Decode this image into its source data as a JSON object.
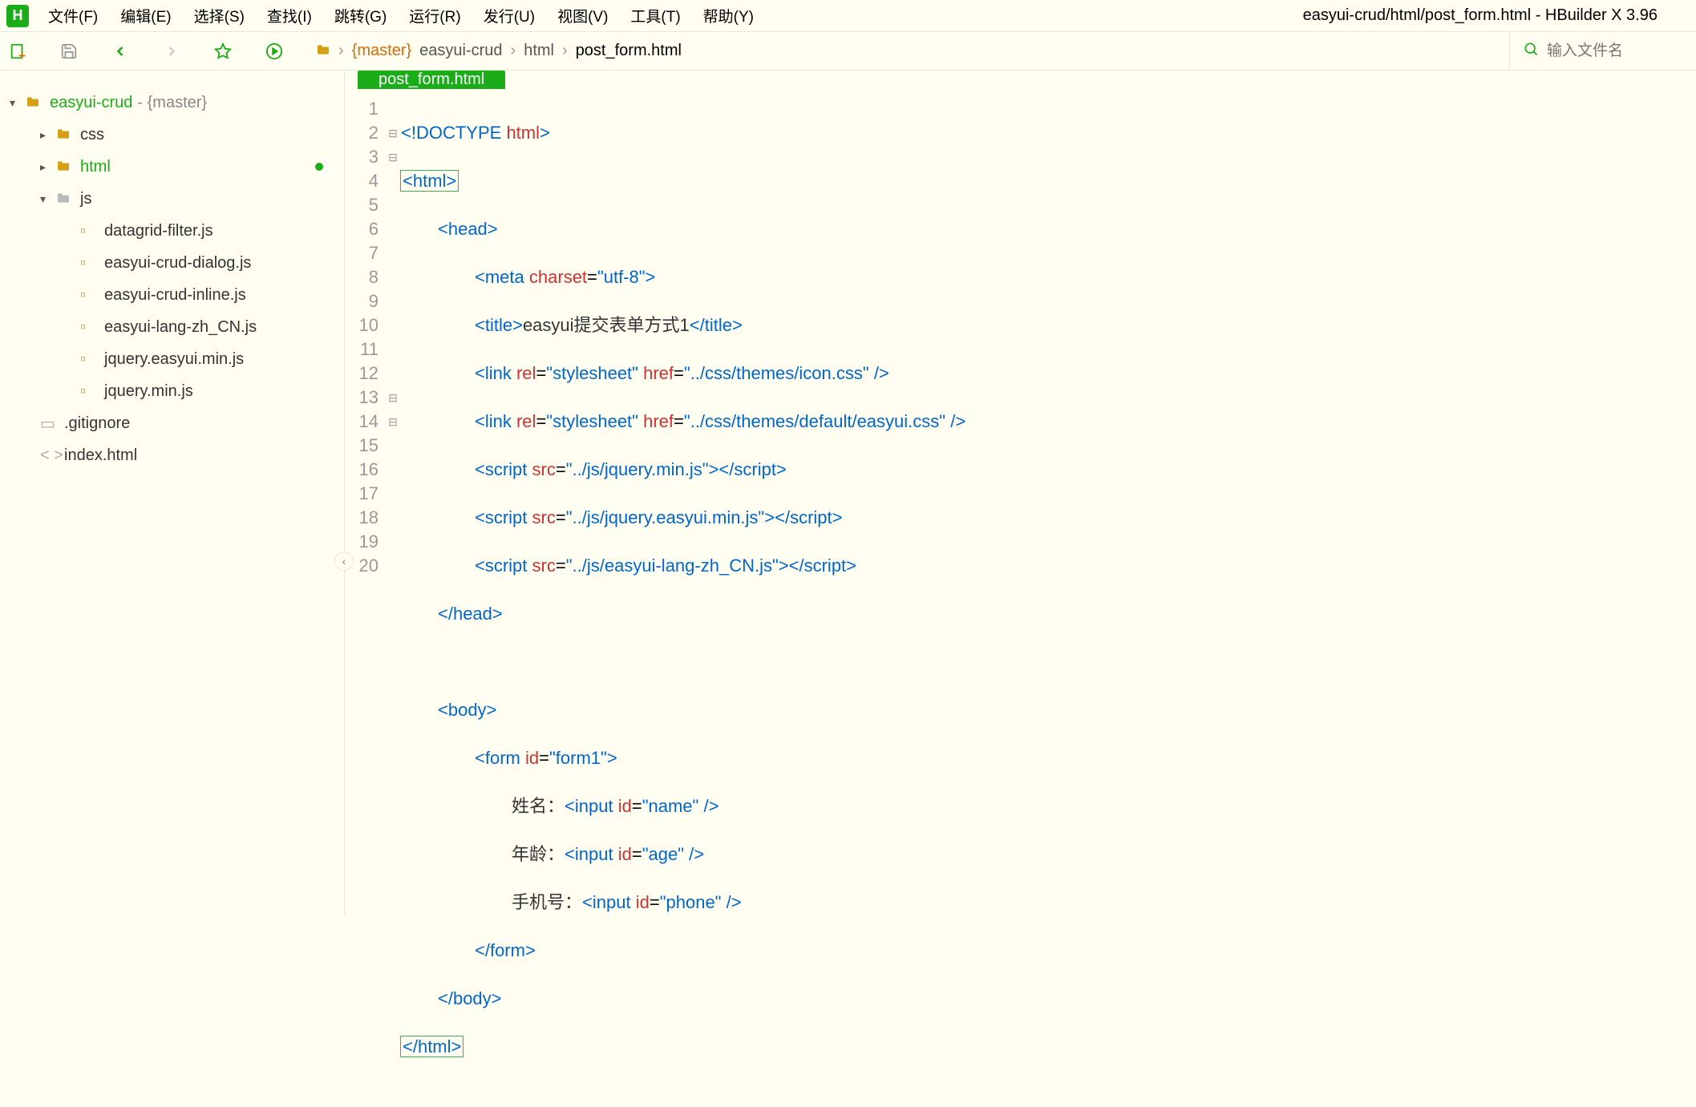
{
  "app": {
    "title": "easyui-crud/html/post_form.html - HBuilder X 3.96",
    "logo": "H"
  },
  "menu": {
    "file": "文件(F)",
    "edit": "编辑(E)",
    "select": "选择(S)",
    "find": "查找(I)",
    "goto": "跳转(G)",
    "run": "运行(R)",
    "publish": "发行(U)",
    "view": "视图(V)",
    "tools": "工具(T)",
    "help": "帮助(Y)"
  },
  "search": {
    "placeholder": "输入文件名"
  },
  "breadcrumb": {
    "branch": "{master}",
    "parts": [
      "easyui-crud",
      "html"
    ],
    "file": "post_form.html"
  },
  "sidebar": {
    "root": {
      "name": "easyui-crud",
      "branch": "- {master}"
    },
    "folders": [
      {
        "name": "css",
        "expanded": false
      },
      {
        "name": "html",
        "expanded": false,
        "active": true
      },
      {
        "name": "js",
        "expanded": true,
        "files": [
          "datagrid-filter.js",
          "easyui-crud-dialog.js",
          "easyui-crud-inline.js",
          "easyui-lang-zh_CN.js",
          "jquery.easyui.min.js",
          "jquery.min.js"
        ]
      }
    ],
    "rootFiles": [
      {
        "name": ".gitignore",
        "icon": "file"
      },
      {
        "name": "index.html",
        "icon": "code"
      }
    ]
  },
  "tab": {
    "label": "post_form.html"
  },
  "code": {
    "lineCount": 20,
    "folds": {
      "2": "⊟",
      "3": "⊟",
      "13": "⊟",
      "14": "⊟"
    }
  },
  "strings": {
    "doctype": "<!DOCTYPE",
    "html_kw": "html",
    "html_open": "<html>",
    "html_close": "</html>",
    "head_open": "<head>",
    "head_close": "</head>",
    "body_open": "<body>",
    "body_close": "</body>",
    "meta": "<meta",
    "charset": "charset",
    "charset_val": "\"utf-8\"",
    "title_open": "<title>",
    "title_text": "easyui提交表单方式1",
    "title_close": "</title>",
    "link": "<link",
    "rel": "rel",
    "rel_val": "\"stylesheet\"",
    "href": "href",
    "href1": "\"../css/themes/icon.css\"",
    "href2": "\"../css/themes/default/easyui.css\"",
    "selfclose": "/>",
    "gt": ">",
    "script_open": "<script",
    "script_close": "</script>",
    "src": "src",
    "src1": "\"../js/jquery.min.js\"",
    "src2": "\"../js/jquery.easyui.min.js\"",
    "src3": "\"../js/easyui-lang-zh_CN.js\"",
    "form_open": "<form",
    "id": "id",
    "form_id": "\"form1\"",
    "form_close": "</form>",
    "label_name": "姓名：",
    "label_age": "年龄：",
    "label_phone": "手机号：",
    "input": "<input",
    "id_name": "\"name\"",
    "id_age": "\"age\"",
    "id_phone": "\"phone\""
  }
}
